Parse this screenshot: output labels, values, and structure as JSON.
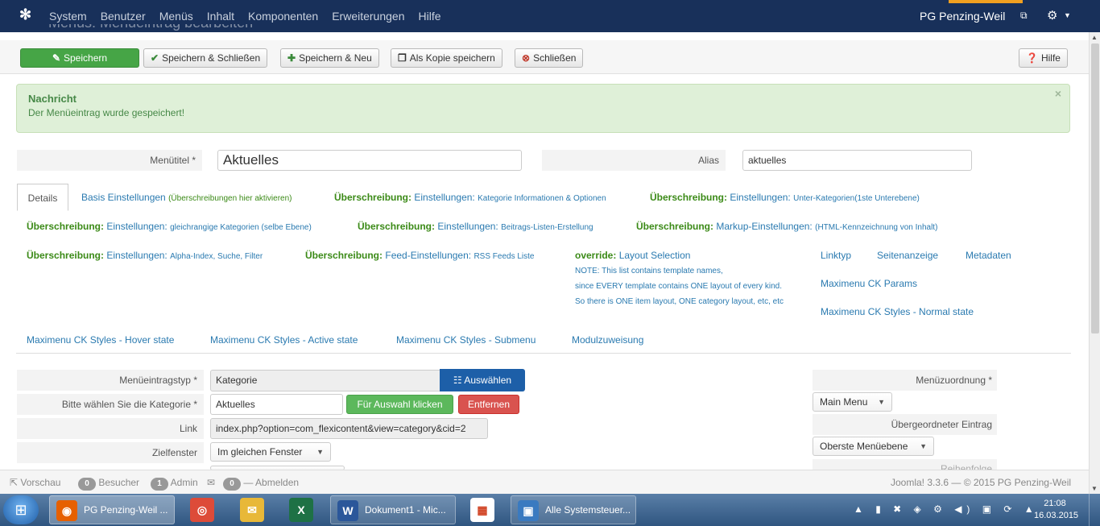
{
  "navbar": {
    "menu": [
      "System",
      "Benutzer",
      "Menüs",
      "Inhalt",
      "Komponenten",
      "Erweiterungen",
      "Hilfe"
    ],
    "site_name": "PG Penzing-Weil",
    "page_title": "Menüs: Menüeintrag bearbeiten"
  },
  "toolbar": {
    "save": "Speichern",
    "save_close": "Speichern & Schließen",
    "save_new": "Speichern & Neu",
    "save_copy": "Als Kopie speichern",
    "close": "Schließen",
    "help": "Hilfe"
  },
  "message": {
    "heading": "Nachricht",
    "text": "Der Menüeintrag wurde gespeichert!",
    "close": "×"
  },
  "title_row": {
    "title_label": "Menütitel *",
    "title_value": "Aktuelles",
    "alias_label": "Alias",
    "alias_value": "aktuelles"
  },
  "tabs": {
    "details": "Details",
    "t1_a": "Basis Einstellungen",
    "t1_b": "(Überschreibungen hier aktivieren)",
    "override_word": "Überschreibung:",
    "t2_a": "Einstellungen:",
    "t2_b": "Kategorie Informationen & Optionen",
    "t3_a": "Einstellungen:",
    "t3_b": "Unter-Kategorien(1ste Unterebene)",
    "t4_a": "Einstellungen:",
    "t4_b": "gleichrangige Kategorien (selbe Ebene)",
    "t5_a": "Einstellungen:",
    "t5_b": "Beitrags-Listen-Erstellung",
    "t6_a": "Markup-Einstellungen:",
    "t6_b": "(HTML-Kennzeichnung von Inhalt)",
    "t7_a": "Einstellungen:",
    "t7_b": "Alpha-Index, Suche, Filter",
    "t8_a": "Feed-Einstellungen:",
    "t8_b": "RSS Feeds Liste",
    "override_en": "override:",
    "t9": "Layout Selection",
    "note1": "NOTE: This list contains template names,",
    "note2": "since EVERY template contains ONE layout of every kind.",
    "note3": "So there is ONE item layout, ONE category layout, etc, etc",
    "linktyp": "Linktyp",
    "seitenanzeige": "Seitenanzeige",
    "metadaten": "Metadaten",
    "maxi_params": "Maximenu CK Params",
    "maxi_normal": "Maximenu CK Styles - Normal state",
    "maxi_hover": "Maximenu CK Styles - Hover state",
    "maxi_active": "Maximenu CK Styles - Active state",
    "maxi_sub": "Maximenu CK Styles - Submenu",
    "modul": "Modulzuweisung"
  },
  "form": {
    "type_label": "Menüeintragstyp *",
    "type_value": "Kategorie",
    "choose": "Auswählen",
    "cat_label": "Bitte wählen Sie die Kategorie *",
    "cat_value": "Aktuelles",
    "pick": "Für Auswahl klicken",
    "remove": "Entfernen",
    "link_label": "Link",
    "link_value": "index.php?option=com_flexicontent&view=category&cid=2",
    "target_label": "Zielfenster",
    "target_value": "Im gleichen Fenster"
  },
  "sidebar": {
    "menu_label": "Menüzuordnung *",
    "menu_value": "Main Menu",
    "parent_label": "Übergeordneter Eintrag",
    "parent_value": "Oberste Menüebene",
    "order_label": "Reihenfolge"
  },
  "status": {
    "preview": "Vorschau",
    "visitors_count": "0",
    "visitors": "Besucher",
    "admin_count": "1",
    "admin": "Admin",
    "msg_count": "0",
    "logout": "Abmelden",
    "version": "Joomla! 3.3.6 — © 2015 PG Penzing-Weil"
  },
  "taskbar": {
    "task1": "PG Penzing-Weil ...",
    "task2": "Dokument1 - Mic...",
    "task3": "Alle Systemsteuer...",
    "time": "21:08",
    "date": "16.03.2015"
  },
  "colors": {
    "navbar": "#18305a",
    "save": "#46a546",
    "link": "#2a7ab0",
    "override": "#3b8a17",
    "choose": "#1d5fa8",
    "remove": "#d9534f"
  }
}
